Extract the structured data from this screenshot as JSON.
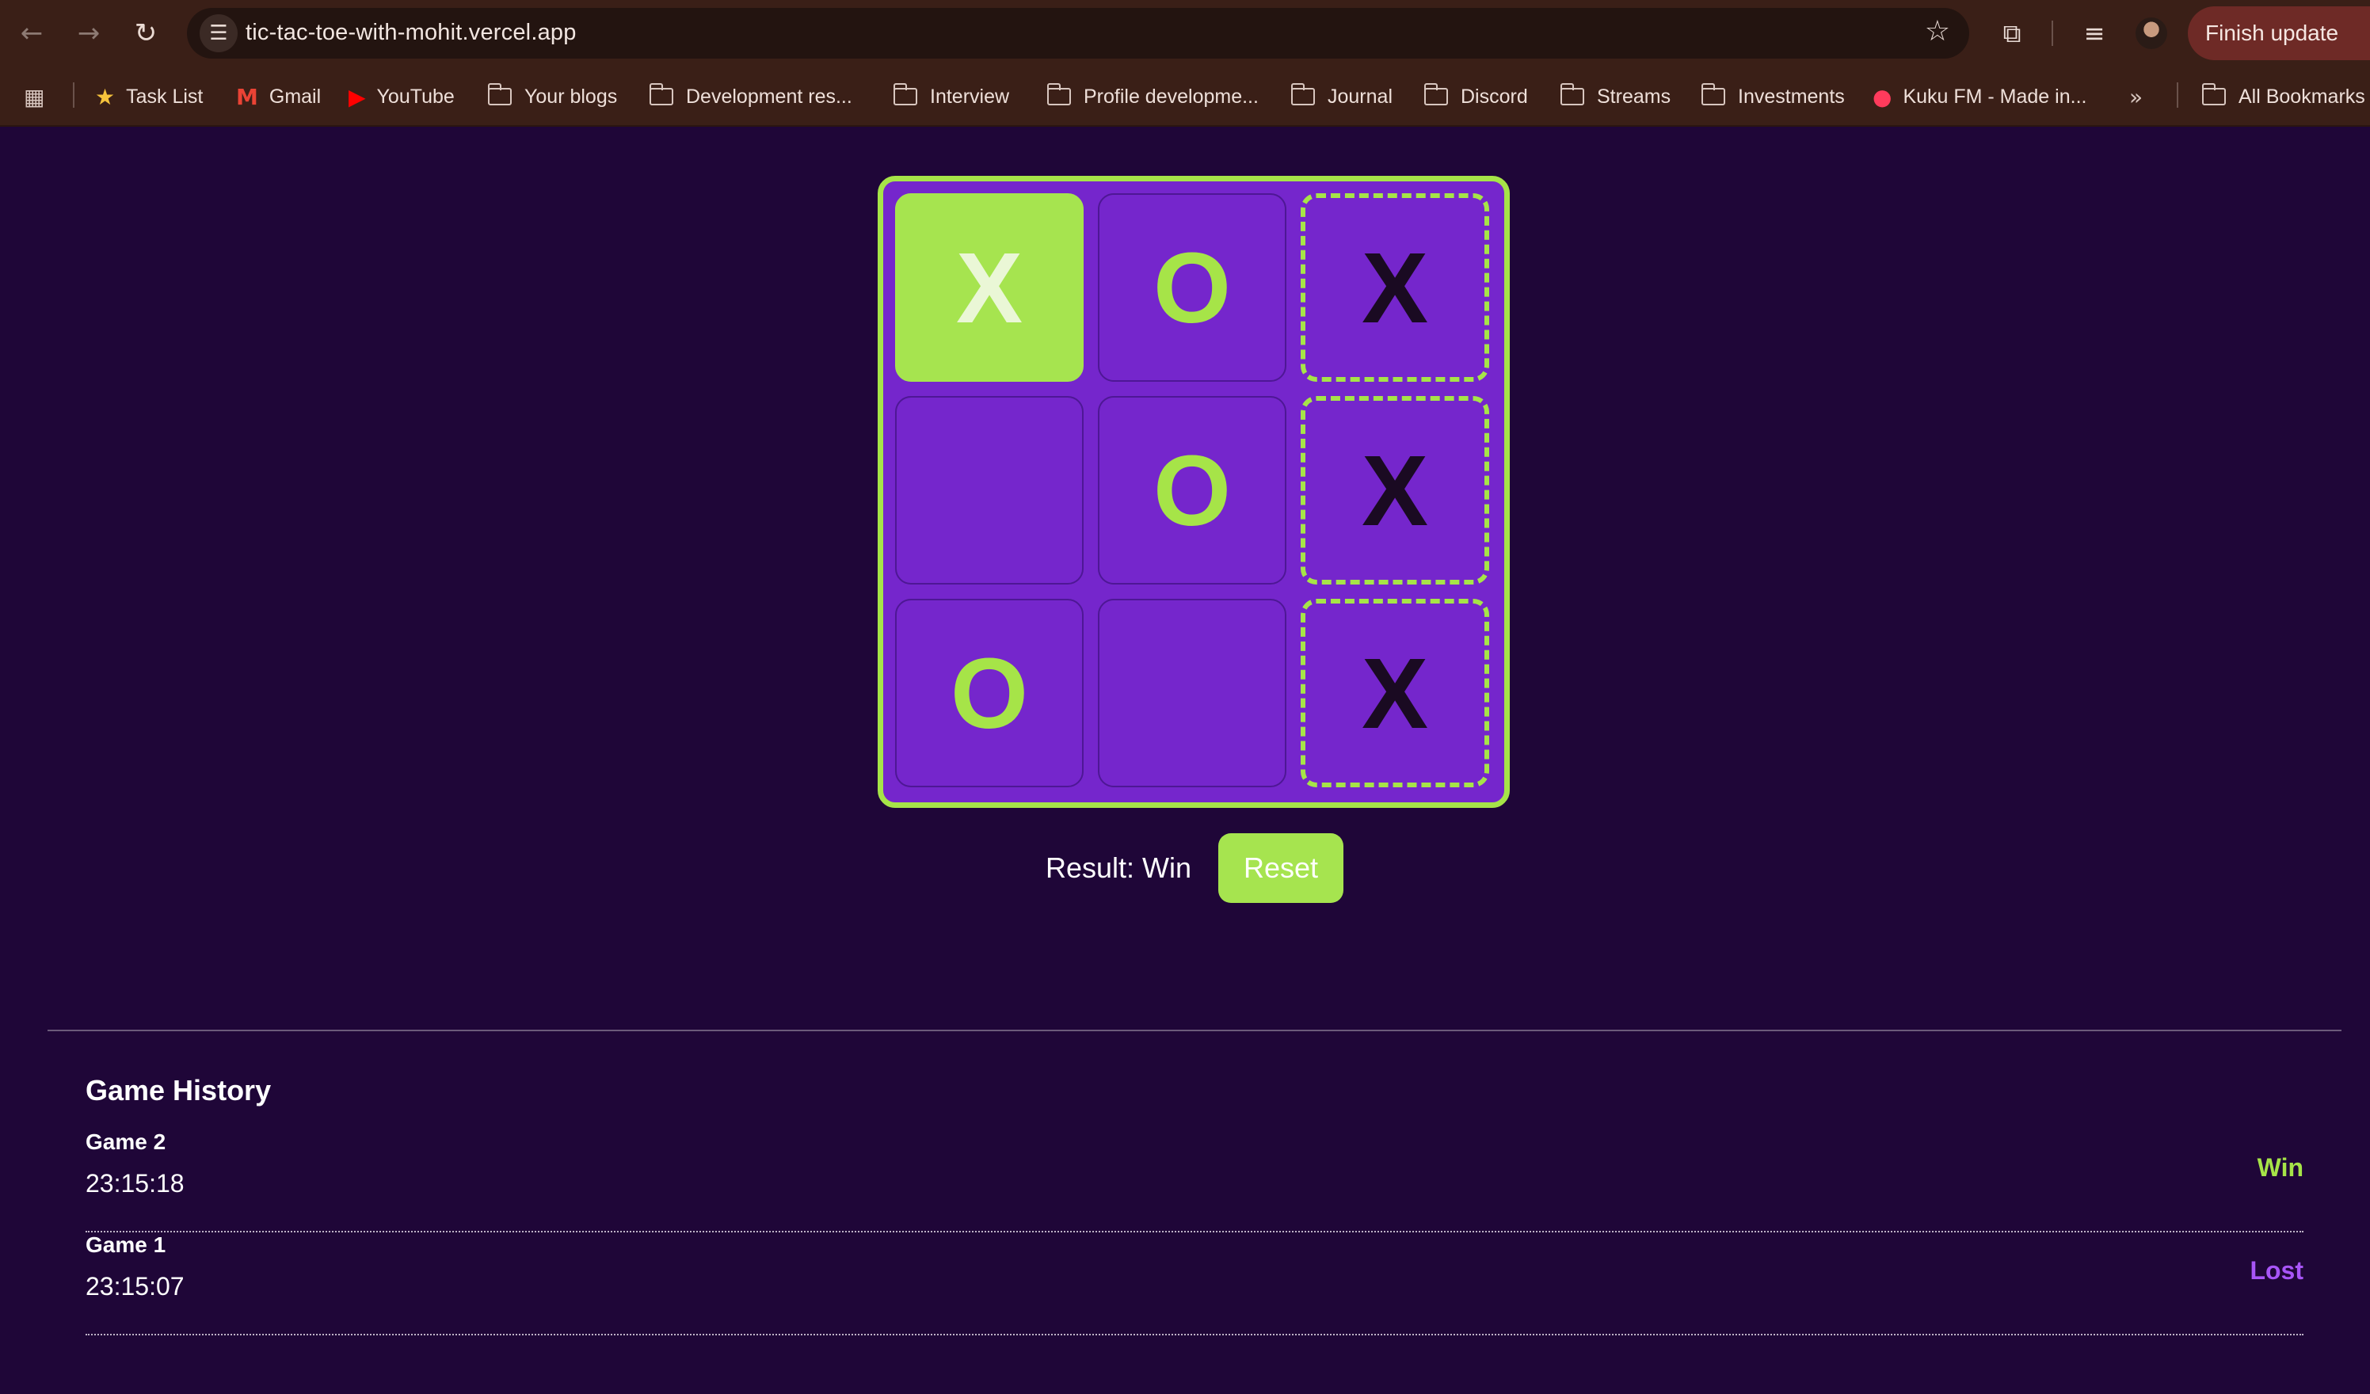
{
  "browser": {
    "url": "tic-tac-toe-with-mohit.vercel.app",
    "finish_update_label": "Finish update",
    "bookmarks": [
      {
        "label": "Task List",
        "icon": "star-icon"
      },
      {
        "label": "Gmail",
        "icon": "gmail-icon"
      },
      {
        "label": "YouTube",
        "icon": "youtube-icon"
      },
      {
        "label": "Your blogs",
        "icon": "folder-icon"
      },
      {
        "label": "Development res...",
        "icon": "folder-icon"
      },
      {
        "label": "Interview",
        "icon": "folder-icon"
      },
      {
        "label": "Profile developme...",
        "icon": "folder-icon"
      },
      {
        "label": "Journal",
        "icon": "folder-icon"
      },
      {
        "label": "Discord",
        "icon": "folder-icon"
      },
      {
        "label": "Streams",
        "icon": "folder-icon"
      },
      {
        "label": "Investments",
        "icon": "folder-icon"
      },
      {
        "label": "Kuku FM - Made in...",
        "icon": "kukufm-icon"
      }
    ],
    "all_bookmarks_label": "All Bookmarks"
  },
  "game": {
    "board": [
      [
        "X",
        "O",
        "X"
      ],
      [
        "",
        "O",
        "X"
      ],
      [
        "O",
        "",
        "X"
      ]
    ],
    "result_text": "Result: Win",
    "reset_label": "Reset",
    "colors": {
      "accent_green": "#a6e448",
      "cell_purple": "#7526cc",
      "background": "#1f0638"
    }
  },
  "history": {
    "title": "Game History",
    "games": [
      {
        "name": "Game 2",
        "time": "23:15:18",
        "result": "Win",
        "color": "#a6e448"
      },
      {
        "name": "Game 1",
        "time": "23:15:07",
        "result": "Lost",
        "color": "#a855f7"
      }
    ]
  }
}
